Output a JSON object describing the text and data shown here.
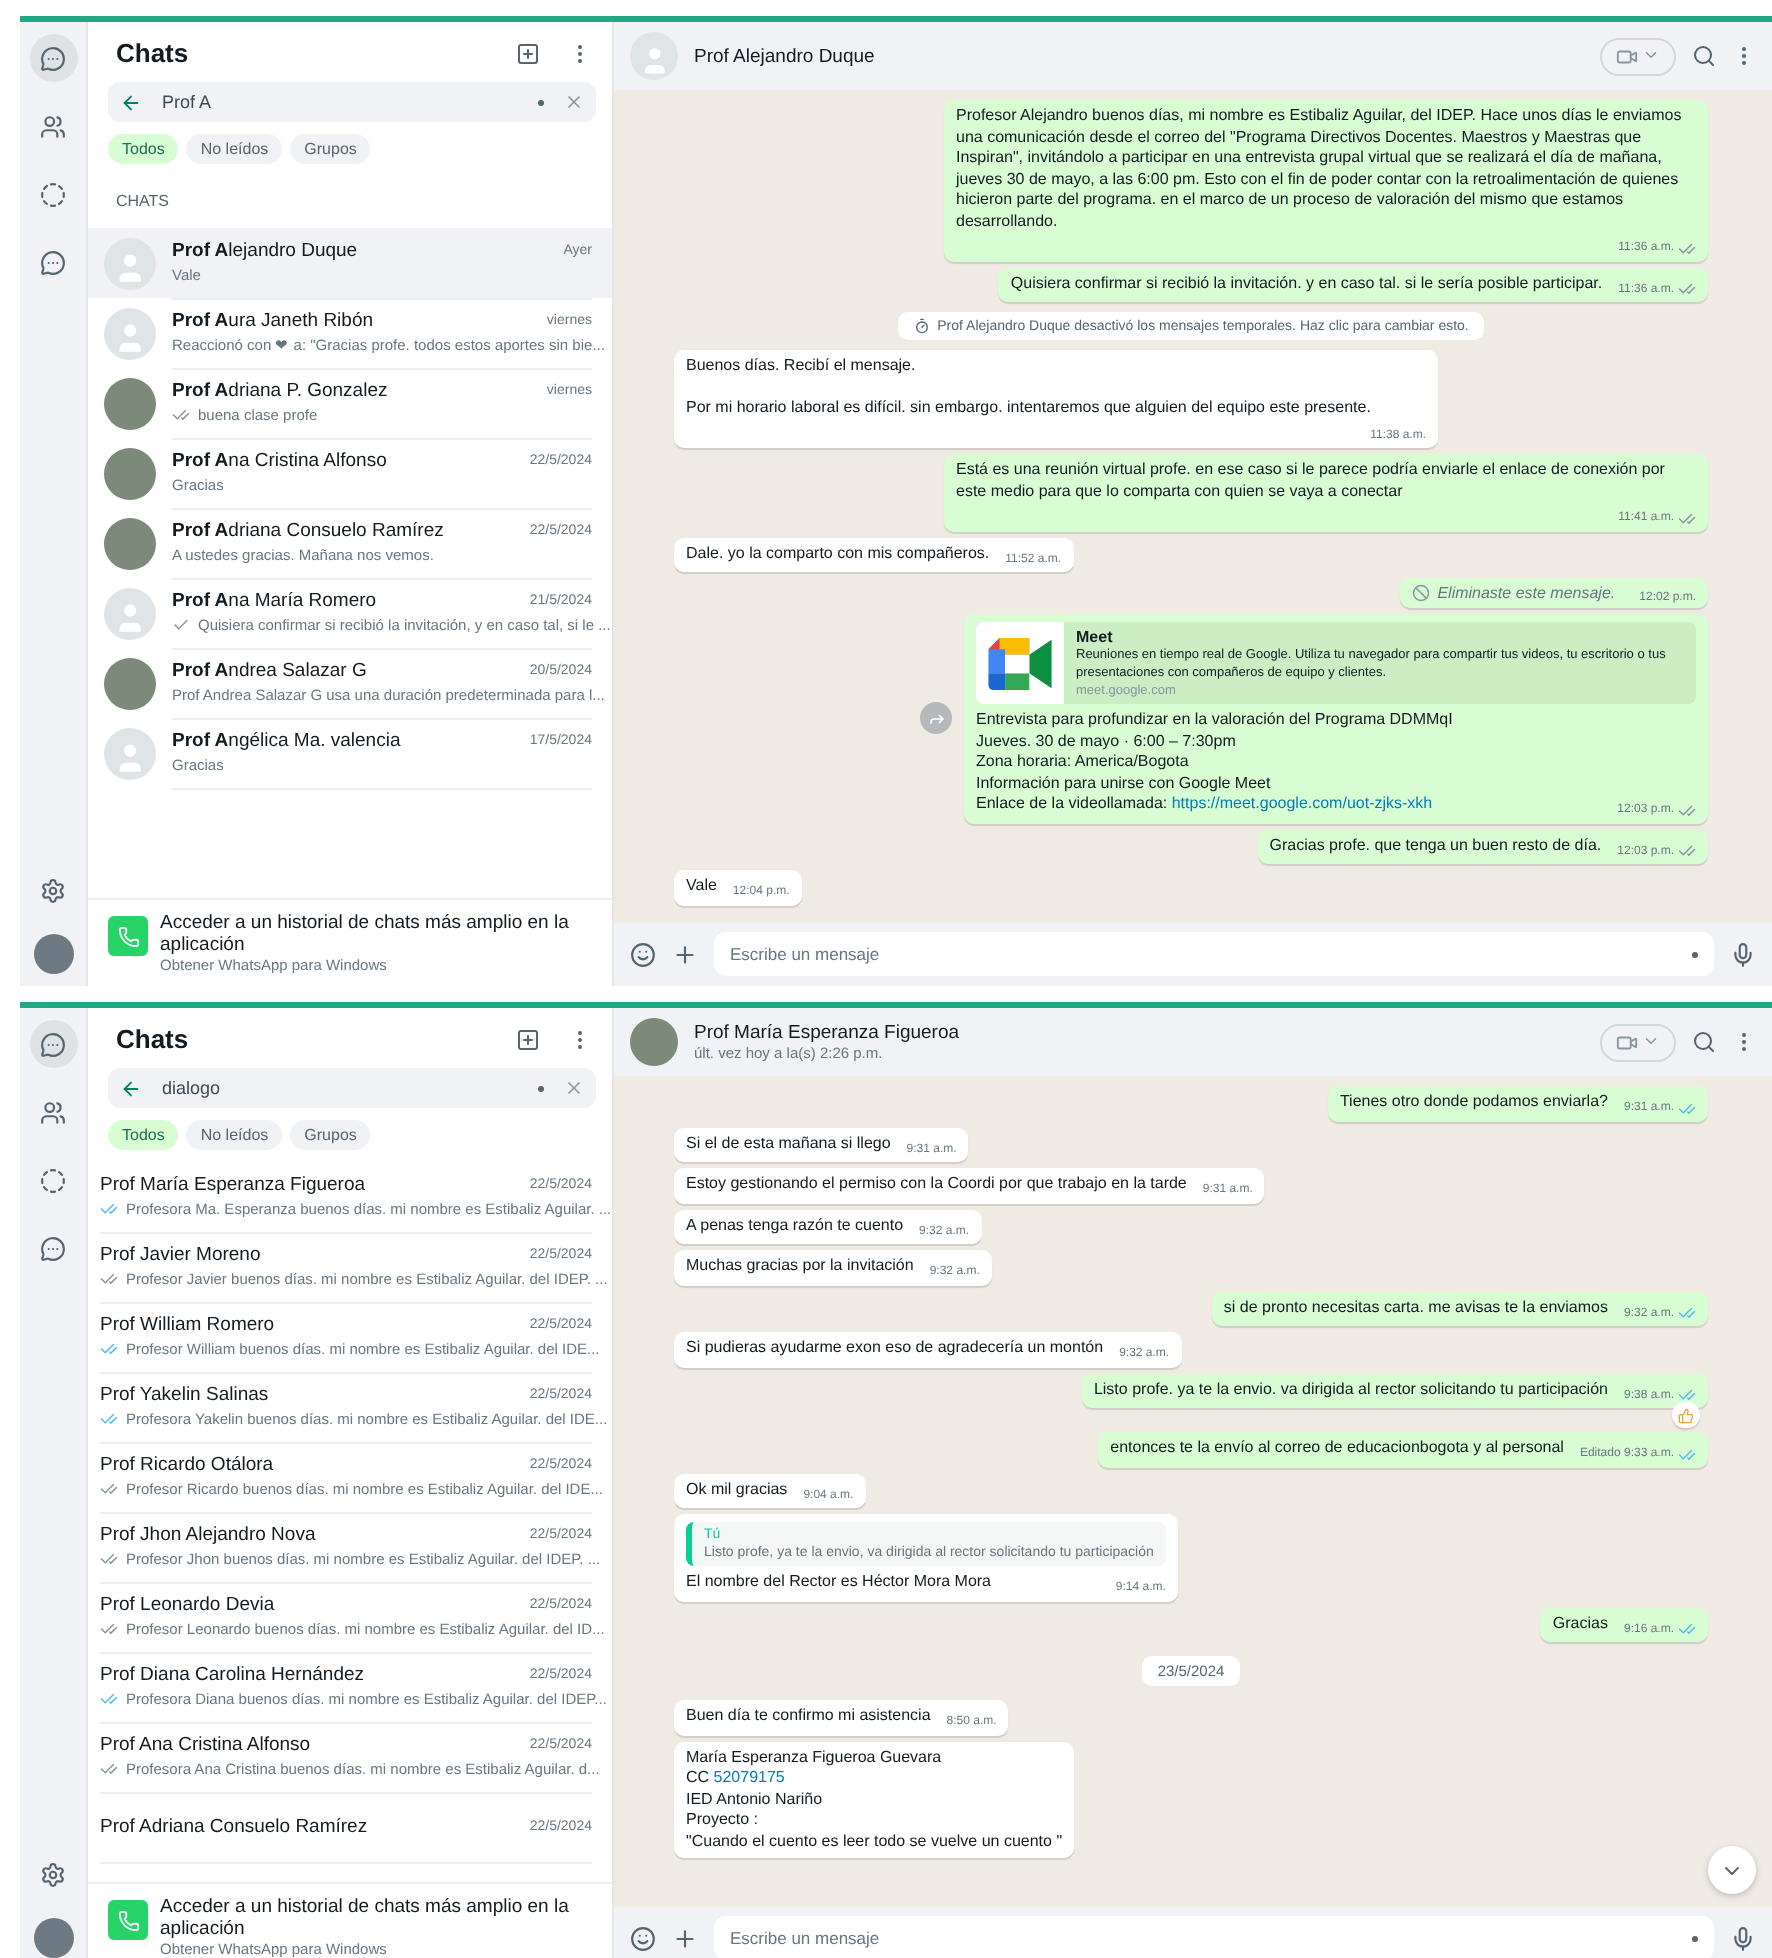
{
  "screens": [
    {
      "chat_list": {
        "title": "Chats",
        "search": {
          "value": "Prof A"
        },
        "filters": [
          {
            "label": "Todos",
            "selected": true
          },
          {
            "label": "No leídos",
            "selected": false
          },
          {
            "label": "Grupos",
            "selected": false
          }
        ],
        "section": "CHATS",
        "chats": [
          {
            "name": "**Prof A**lejandro Duque",
            "time": "Ayer",
            "preview": "Vale",
            "photo": false,
            "selected": true
          },
          {
            "name": "**Prof A**ura Janeth Ribón",
            "time": "viernes",
            "preview": "Reaccionó con ❤ a: \"Gracias profe. todos estos aportes sin bie...",
            "photo": false,
            "selected": false
          },
          {
            "name": "**Prof A**driana P. Gonzalez",
            "time": "viernes",
            "preview": "buena clase profe",
            "delivered": true,
            "read": false,
            "photo": true,
            "selected": false
          },
          {
            "name": "**Prof A**na Cristina Alfonso",
            "time": "22/5/2024",
            "preview": "Gracias",
            "photo": true,
            "selected": false
          },
          {
            "name": "**Prof A**driana Consuelo Ramírez",
            "time": "22/5/2024",
            "preview": "A ustedes gracias.  Mañana nos vemos.",
            "photo": true,
            "selected": false
          },
          {
            "name": "**Prof A**na María Romero",
            "time": "21/5/2024",
            "preview": "Quisiera confirmar si recibió la invitación, y en caso tal, si le ...",
            "delivered": false,
            "read": false,
            "photo": false,
            "selected": false
          },
          {
            "name": "**Prof A**ndrea Salazar G",
            "time": "20/5/2024",
            "preview": "Prof Andrea Salazar G usa una duración predeterminada para l...",
            "photo": true,
            "selected": false
          },
          {
            "name": "**Prof A**ngélica Ma. valencia",
            "time": "17/5/2024",
            "preview": "Gracias",
            "photo": false,
            "selected": false
          }
        ]
      },
      "promo": {
        "title": "Acceder a un historial de chats más amplio en la aplicación",
        "subtitle": "Obtener WhatsApp para Windows"
      },
      "chat": {
        "name": "Prof Alejandro Duque",
        "photo": false,
        "messages": [
          {
            "kind": "out",
            "text": "Profesor Alejandro buenos días, mi nombre es Estibaliz Aguilar, del IDEP. Hace unos días le enviamos una comunicación desde el correo del \"Programa Directivos Docentes. Maestros y Maestras que Inspiran\", invitándolo a participar en una entrevista grupal virtual que se realizará el día de mañana, jueves 30 de mayo, a las 6:00 pm. Esto con el fin de poder contar con la retroalimentación de quienes hicieron parte del programa. en el marco de un proceso de valoración del mismo que estamos desarrollando.",
            "time": "11:36 a.m.",
            "delivered": true,
            "read": false
          },
          {
            "kind": "out",
            "text": "Quisiera confirmar si recibió la invitación. y en caso tal. si le sería posible participar.",
            "time": "11:36 a.m.",
            "delivered": true,
            "read": false
          },
          {
            "kind": "system",
            "text": "Prof Alejandro Duque desactivó los mensajes temporales. Haz clic para cambiar esto."
          },
          {
            "kind": "in",
            "lines": [
              {
                "text": "Buenos días. Recibí el mensaje.",
                "spaced": false
              },
              {
                "text": "Por mi horario laboral es difícil. sin embargo. intentaremos que alguien del equipo este presente.",
                "spaced": true
              }
            ],
            "time": "11:38 a.m."
          },
          {
            "kind": "out",
            "text": "Está es una reunión virtual profe. en ese caso si le parece podría enviarle el enlace de conexión por este medio para que lo comparta con quien se vaya a conectar",
            "time": "11:41 a.m.",
            "delivered": true,
            "read": false
          },
          {
            "kind": "in",
            "text": "Dale. yo la comparto con mis compañeros.",
            "time": "11:52 a.m."
          },
          {
            "kind": "deleted",
            "text": "Eliminaste este mensaje.",
            "time": "12:02 p.m."
          },
          {
            "kind": "out",
            "forward_button": true,
            "preview": {
              "title": "Meet",
              "description": "Reuniones en tiempo real de Google. Utiliza tu navegador para compartir tus videos, tu escritorio o tus presentaciones con compañeros de equipo y clientes.",
              "domain": "meet.google.com"
            },
            "lines": [
              {
                "text": "Entrevista para profundizar en la valoración del Programa DDMMqI"
              },
              {
                "text": "Jueves. 30 de mayo · 6:00 – 7:30pm"
              },
              {
                "text": "Zona horaria: America/Bogota"
              },
              {
                "text": "Información para unirse con Google Meet"
              },
              {
                "text": "Enlace de la videollamada: ",
                "link": "https://meet.google.com/uot-zjks-xkh"
              }
            ],
            "time": "12:03 p.m.",
            "delivered": true,
            "read": false
          },
          {
            "kind": "out",
            "text": "Gracias profe. que tenga un buen resto de día.",
            "time": "12:03 p.m.",
            "delivered": true,
            "read": false
          },
          {
            "kind": "in",
            "text": "Vale",
            "time": "12:04 p.m."
          }
        ]
      },
      "composer": {
        "placeholder": "Escribe un mensaje"
      }
    },
    {
      "chat_list": {
        "title": "Chats",
        "search": {
          "value": "dialogo"
        },
        "filters": [
          {
            "label": "Todos",
            "selected": true
          },
          {
            "label": "No leídos",
            "selected": false
          },
          {
            "label": "Grupos",
            "selected": false
          }
        ],
        "chats": [
          {
            "name": "Prof María Esperanza Figueroa",
            "time": "22/5/2024",
            "preview": "Profesora Ma. Esperanza buenos días. mi nombre es Estibaliz Aguilar. ...",
            "delivered": true,
            "read": true,
            "selected": false
          },
          {
            "name": "Prof Javier Moreno",
            "time": "22/5/2024",
            "preview": "Profesor Javier buenos días. mi nombre es Estibaliz Aguilar. del IDEP. ...",
            "delivered": true,
            "read": false,
            "selected": false
          },
          {
            "name": "Prof William Romero",
            "time": "22/5/2024",
            "preview": "Profesor William buenos días. mi nombre es Estibaliz Aguilar. del IDE...",
            "delivered": true,
            "read": true,
            "selected": false
          },
          {
            "name": "Prof Yakelin Salinas",
            "time": "22/5/2024",
            "preview": "Profesora Yakelin buenos días. mi nombre es Estibaliz Aguilar. del IDE...",
            "delivered": true,
            "read": true,
            "selected": false
          },
          {
            "name": "Prof Ricardo Otálora",
            "time": "22/5/2024",
            "preview": "Profesor Ricardo buenos días. mi nombre es Estibaliz Aguilar. del IDE...",
            "delivered": true,
            "read": false,
            "selected": false
          },
          {
            "name": "Prof Jhon Alejandro Nova",
            "time": "22/5/2024",
            "preview": "Profesor Jhon buenos días. mi nombre es Estibaliz Aguilar. del IDEP. ...",
            "delivered": true,
            "read": false,
            "selected": false
          },
          {
            "name": "Prof Leonardo Devia",
            "time": "22/5/2024",
            "preview": "Profesor Leonardo buenos días. mi nombre es Estibaliz Aguilar. del ID...",
            "delivered": true,
            "read": false,
            "selected": false
          },
          {
            "name": "Prof Diana Carolina Hernández",
            "time": "22/5/2024",
            "preview": "Profesora Diana buenos días. mi nombre es Estibaliz Aguilar. del IDEP...",
            "delivered": true,
            "read": true,
            "selected": false
          },
          {
            "name": "Prof Ana Cristina Alfonso",
            "time": "22/5/2024",
            "preview": "Profesora Ana Cristina buenos días. mi nombre es Estibaliz Aguilar. d...",
            "delivered": true,
            "read": false,
            "selected": false
          },
          {
            "name": "Prof Adriana Consuelo Ramírez",
            "time": "22/5/2024",
            "selected": false
          }
        ]
      },
      "promo": {
        "title": "Acceder a un historial de chats más amplio en la aplicación",
        "subtitle": "Obtener WhatsApp para Windows"
      },
      "chat": {
        "name": "Prof María Esperanza Figueroa",
        "status": "últ. vez hoy a la(s) 2:26 p.m.",
        "photo": true,
        "scroll_button": true,
        "messages": [
          {
            "kind": "out",
            "text": "Tienes otro donde podamos enviarla?",
            "time": "9:31 a.m.",
            "delivered": true,
            "read": true
          },
          {
            "kind": "in",
            "text": "Si el de esta mañana si llego",
            "time": "9:31 a.m."
          },
          {
            "kind": "in",
            "text": "Estoy gestionando el permiso con la Coordi por que trabajo en la tarde",
            "time": "9:31 a.m."
          },
          {
            "kind": "in",
            "text": "A penas tenga razón te cuento",
            "time": "9:32 a.m."
          },
          {
            "kind": "in",
            "text": "Muchas gracias por la invitación",
            "time": "9:32 a.m."
          },
          {
            "kind": "out",
            "text": "si de pronto necesitas carta. me avisas te la enviamos",
            "time": "9:32 a.m.",
            "delivered": true,
            "read": true
          },
          {
            "kind": "in",
            "text": "Si pudieras ayudarme exon eso de agradecería un montón",
            "time": "9:32 a.m."
          },
          {
            "kind": "out",
            "text": "Listo profe. ya te la envio. va dirigida al rector solicitando tu participación",
            "time": "9:38 a.m.",
            "delivered": true,
            "read": true,
            "reacted": true
          },
          {
            "kind": "out",
            "text": "entonces te la envío al correo de educacionbogota y al personal",
            "time": "Editado 9:33 a.m.",
            "delivered": true,
            "read": true
          },
          {
            "kind": "in",
            "text": "Ok mil gracias",
            "time": "9:04 a.m."
          },
          {
            "kind": "in",
            "quote": {
              "author": "Tú",
              "text": "Listo profe, ya te la envio, va dirigida al rector solicitando tu participación"
            },
            "text": "El nombre del Rector es Héctor Mora Mora",
            "time": "9:14 a.m."
          },
          {
            "kind": "out",
            "text": "Gracias",
            "time": "9:16 a.m.",
            "delivered": true,
            "read": true
          },
          {
            "kind": "date",
            "text": "23/5/2024"
          },
          {
            "kind": "in",
            "text": "Buen día te confirmo mi asistencia",
            "time": "8:50 a.m."
          },
          {
            "kind": "in",
            "lines": [
              {
                "text": "María Esperanza Figueroa Guevara"
              },
              {
                "text": "CC ",
                "link": "52079175"
              },
              {
                "text": "IED Antonio Nariño"
              },
              {
                "text": "Proyecto :"
              },
              {
                "text": "\"Cuando el cuento es leer todo se vuelve un cuento \""
              }
            ]
          }
        ]
      },
      "composer": {
        "placeholder": "Escribe un mensaje"
      }
    }
  ]
}
